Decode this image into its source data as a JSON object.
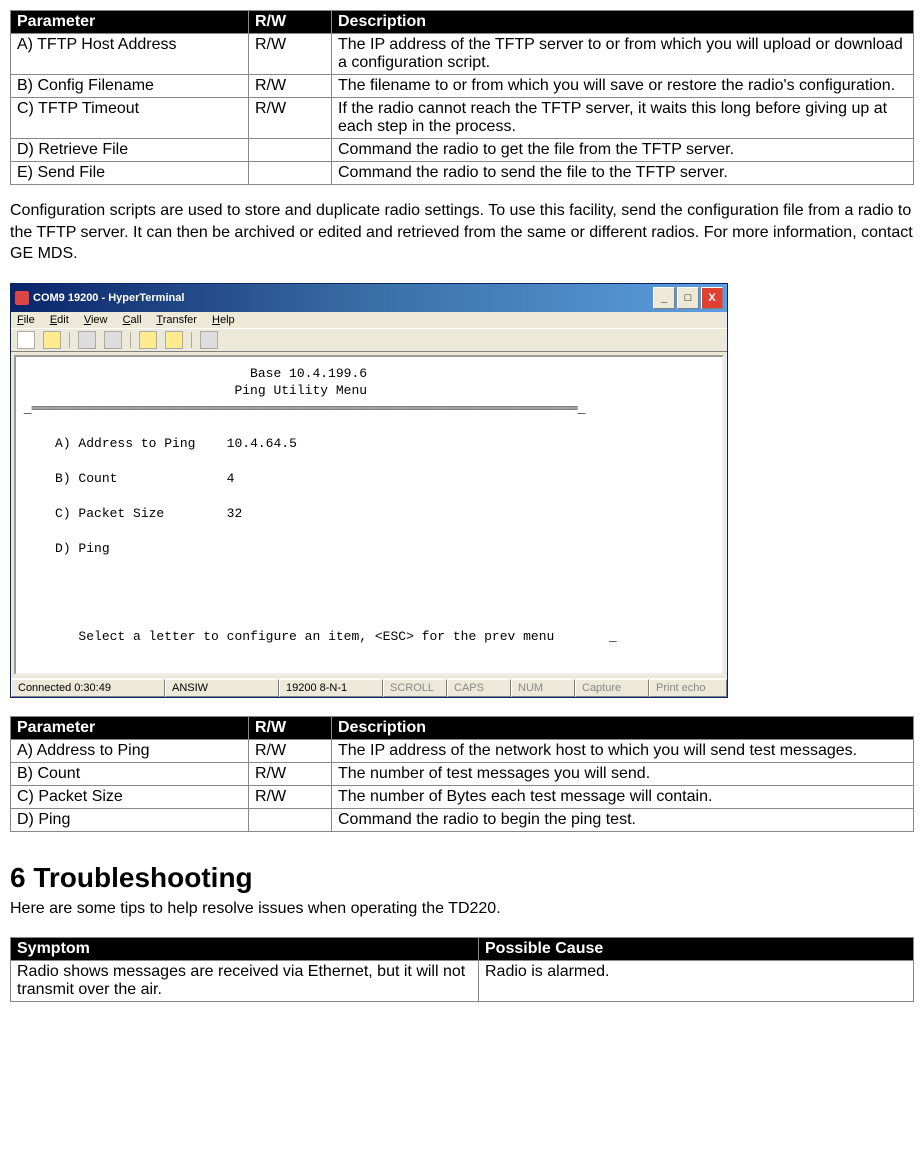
{
  "table1": {
    "headers": {
      "param": "Parameter",
      "rw": "R/W",
      "desc": "Description"
    },
    "rows": [
      {
        "param": "A) TFTP Host Address",
        "rw": "R/W",
        "desc": "The IP address of the TFTP server to or from which you will upload or download a configuration script."
      },
      {
        "param": "B) Config Filename",
        "rw": "R/W",
        "desc": "The filename to or from which you will save or restore the radio's configuration."
      },
      {
        "param": "C) TFTP Timeout",
        "rw": "R/W",
        "desc": "If the radio cannot reach the TFTP server, it waits this long before giving up at each step in the process."
      },
      {
        "param": "D) Retrieve File",
        "rw": "",
        "desc": "Command the radio to get the file from the TFTP server."
      },
      {
        "param": "E) Send File",
        "rw": "",
        "desc": "Command the radio to send the file to the TFTP server."
      }
    ]
  },
  "paragraph1": "Configuration scripts are used to store and duplicate radio settings.  To use this facility, send the configuration file from a radio to the TFTP server.  It can then be archived or edited and retrieved from the same or different radios.  For more information, contact GE MDS.",
  "hyperterminal": {
    "title": "COM9 19200 - HyperTerminal",
    "menus": {
      "file": "File",
      "edit": "Edit",
      "view": "View",
      "call": "Call",
      "transfer": "Transfer",
      "help": "Help"
    },
    "terminal": {
      "header_ip": "Base 10.4.199.6",
      "header_title": "Ping Utility Menu",
      "lines": [
        {
          "label": "A) Address to Ping",
          "value": "10.4.64.5"
        },
        {
          "label": "B) Count",
          "value": "4"
        },
        {
          "label": "C) Packet Size",
          "value": "32"
        },
        {
          "label": "D) Ping",
          "value": ""
        }
      ],
      "footer": "Select a letter to configure an item, <ESC> for the prev menu"
    },
    "status": {
      "connected": "Connected 0:30:49",
      "emulation": "ANSIW",
      "settings": "19200 8-N-1",
      "scroll": "SCROLL",
      "caps": "CAPS",
      "num": "NUM",
      "capture": "Capture",
      "echo": "Print echo"
    }
  },
  "table2": {
    "headers": {
      "param": "Parameter",
      "rw": "R/W",
      "desc": "Description"
    },
    "rows": [
      {
        "param": "A) Address to Ping",
        "rw": "R/W",
        "desc": "The IP address of the network host to which you will send test messages."
      },
      {
        "param": "B) Count",
        "rw": "R/W",
        "desc": "The number of test messages you will send."
      },
      {
        "param": "C) Packet Size",
        "rw": "R/W",
        "desc": "The number of Bytes each test message will contain."
      },
      {
        "param": "D) Ping",
        "rw": "",
        "desc": "Command the radio to begin the ping test."
      }
    ]
  },
  "section6": {
    "heading": "6   Troubleshooting",
    "intro": "Here are some tips to help resolve issues when operating the TD220."
  },
  "table3": {
    "headers": {
      "symptom": "Symptom",
      "cause": "Possible Cause"
    },
    "rows": [
      {
        "symptom": "Radio shows messages are received via Ethernet, but it will not transmit over the air.",
        "cause": "Radio is alarmed."
      }
    ]
  }
}
